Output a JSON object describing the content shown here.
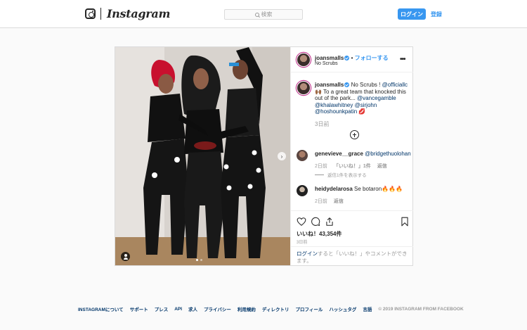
{
  "header": {
    "wordmark": "Instagram",
    "search_placeholder": "検索",
    "login_label": "ログイン",
    "signup_label": "登録"
  },
  "post": {
    "username": "joansmalls",
    "separator": " • ",
    "follow_label": "フォローする",
    "location": "No Scrubs",
    "caption_prefix": " No Scrubs ! ",
    "caption_mention1": "@officiallc",
    "caption_body": " 🙌🏾 To a great team that knocked this out of the park... ",
    "caption_mention2": "@vancegamble",
    "caption_mention3": "@khalawhitney",
    "caption_mention4": "@sirjohn",
    "caption_mention5": "@hoshounkpatin",
    "caption_emoji": " 💋",
    "caption_time": "3日前",
    "comments": [
      {
        "username": "genevieve__grace",
        "text": "@bridgethuolohan",
        "time": "2日前",
        "likes": "「いいね！」1件",
        "reply": "返信",
        "view_replies": "返信1件を表示する"
      },
      {
        "username": "heidydelarosa",
        "text": "Se botaron🔥🔥🔥",
        "time": "2日前",
        "reply": "返信"
      }
    ],
    "likes_label": "いいね！43,354件",
    "date": "3日前",
    "login_link": "ログイン",
    "login_prompt": "すると「いいね！」やコメントができます。"
  },
  "footer": {
    "links": [
      "INSTAGRAMについて",
      "サポート",
      "プレス",
      "API",
      "求人",
      "プライバシー",
      "利用規約",
      "ディレクトリ",
      "プロフィール",
      "ハッシュタグ",
      "言語"
    ],
    "copyright": "© 2019 INSTAGRAM FROM FACEBOOK"
  },
  "colors": {
    "accent": "#3897f0",
    "link": "#003569",
    "muted": "#999999",
    "border": "#dbdbdb"
  },
  "icons": [
    "instagram-camera-icon",
    "search-icon",
    "verified-icon",
    "more-icon",
    "add-comment-icon",
    "heart-icon",
    "comment-icon",
    "share-icon",
    "bookmark-icon",
    "tag-user-icon",
    "carousel-next-icon"
  ]
}
